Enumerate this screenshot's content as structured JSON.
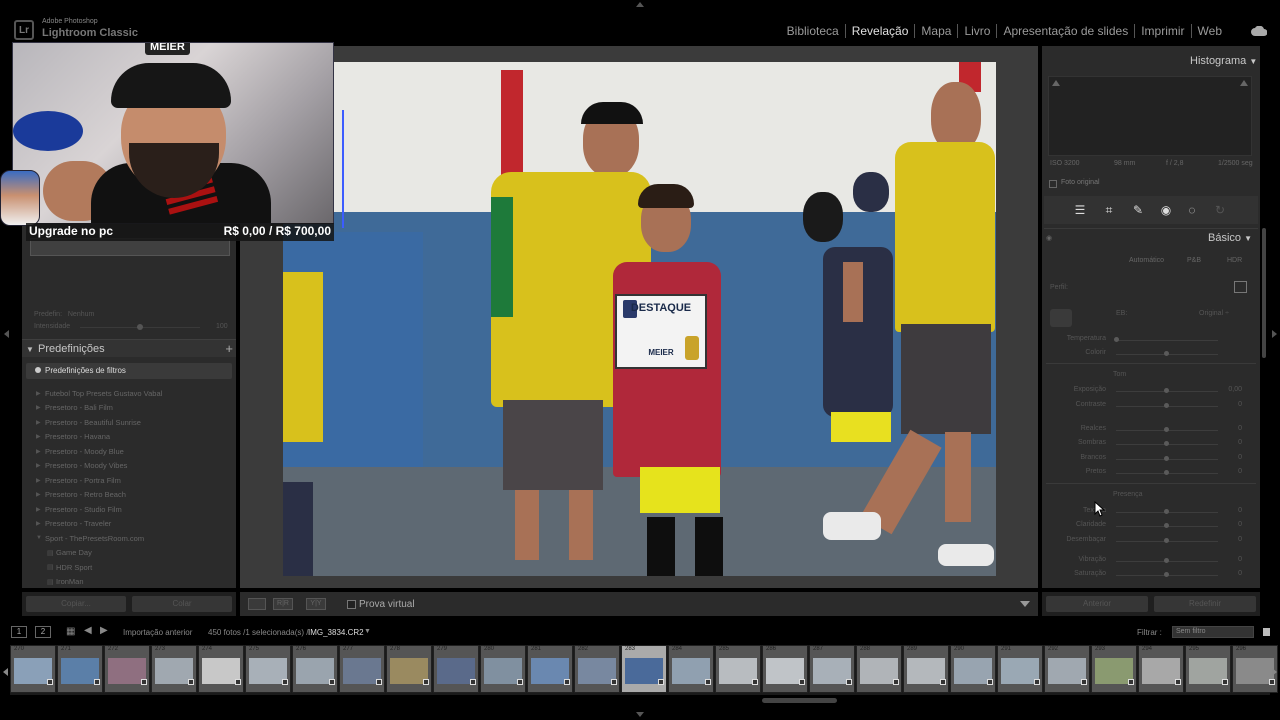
{
  "app": {
    "vendor": "Adobe Photoshop",
    "name": "Lightroom Classic"
  },
  "modules": [
    {
      "label": "Biblioteca",
      "active": false
    },
    {
      "label": "Revelação",
      "active": true
    },
    {
      "label": "Mapa",
      "active": false
    },
    {
      "label": "Livro",
      "active": false
    },
    {
      "label": "Apresentação de slides",
      "active": false
    },
    {
      "label": "Imprimir",
      "active": false
    },
    {
      "label": "Web",
      "active": false
    }
  ],
  "overlay": {
    "cap_logo": "MEIER",
    "upgrade_label": "Upgrade no pc",
    "goal": "R$ 0,00 / R$ 700,00"
  },
  "left_panel": {
    "preset_label": "Predefin:",
    "preset_value": "Nenhum",
    "intensity_label": "Intensidade",
    "intensity_value": "100",
    "intensity_fraction": 0.5,
    "presets_title": "Predefinições",
    "filter_presets": "Predefinições de filtros",
    "presets": [
      {
        "label": "Futebol Top Presets Gustavo Vabal",
        "type": "folder"
      },
      {
        "label": "Presetoro - Bali Film",
        "type": "folder"
      },
      {
        "label": "Presetoro - Beautiful Sunrise",
        "type": "folder"
      },
      {
        "label": "Presetoro - Havana",
        "type": "folder"
      },
      {
        "label": "Presetoro - Moody Blue",
        "type": "folder"
      },
      {
        "label": "Presetoro - Moody Vibes",
        "type": "folder"
      },
      {
        "label": "Presetoro - Portra Film",
        "type": "folder"
      },
      {
        "label": "Presetoro - Retro Beach",
        "type": "folder"
      },
      {
        "label": "Presetoro - Studio Film",
        "type": "folder"
      },
      {
        "label": "Presetoro - Traveler",
        "type": "folder"
      },
      {
        "label": "Sport - ThePresetsRoom.com",
        "type": "open"
      },
      {
        "label": "Game Day",
        "type": "item"
      },
      {
        "label": "HDR Sport",
        "type": "item"
      },
      {
        "label": "IronMan",
        "type": "item"
      }
    ],
    "copy_button": "Copiar...",
    "paste_button": "Colar"
  },
  "photo": {
    "certificate_title": "DESTAQUE",
    "certificate_name": "MEIER"
  },
  "center_toolbar": {
    "proof_label": "Prova virtual"
  },
  "right_panel": {
    "histogram_title": "Histograma",
    "iso": "ISO 3200",
    "focal": "98 mm",
    "aperture": "f / 2,8",
    "shutter": "1/2500 seg",
    "original_photo": "Foto original",
    "basic_title": "Básico",
    "mode_auto": "Automático",
    "mode_bw": "P&B",
    "mode_hdr": "HDR",
    "profile_label": "Perfil:",
    "wb_label": "EB:",
    "wb_value": "Original ÷",
    "tone_label": "Tom",
    "presence_label": "Presença",
    "sliders": [
      {
        "name": "Temperatura",
        "value": "",
        "pos": 0.0
      },
      {
        "name": "Colorir",
        "value": "",
        "pos": 0.5
      },
      {
        "name": "Exposição",
        "value": "0,00",
        "pos": 0.5
      },
      {
        "name": "Contraste",
        "value": "0",
        "pos": 0.5
      },
      {
        "name": "Realces",
        "value": "0",
        "pos": 0.5
      },
      {
        "name": "Sombras",
        "value": "0",
        "pos": 0.5
      },
      {
        "name": "Brancos",
        "value": "0",
        "pos": 0.5
      },
      {
        "name": "Pretos",
        "value": "0",
        "pos": 0.5
      },
      {
        "name": "Textura",
        "value": "0",
        "pos": 0.5
      },
      {
        "name": "Claridade",
        "value": "0",
        "pos": 0.5
      },
      {
        "name": "Desembaçar",
        "value": "0",
        "pos": 0.5
      },
      {
        "name": "Vibração",
        "value": "0",
        "pos": 0.5
      },
      {
        "name": "Saturação",
        "value": "0",
        "pos": 0.5
      }
    ],
    "prev_button": "Anterior",
    "reset_button": "Redefinir"
  },
  "filmbar": {
    "screen1": "1",
    "screen2": "2",
    "source": "Importação anterior",
    "count": "450 fotos /1 selecionada(s) /",
    "filename": "IMG_3834.CR2",
    "filter_label": "Filtrar :",
    "filter_value": "Sem filtro"
  },
  "filmstrip": {
    "numbers": [
      "270",
      "271",
      "272",
      "273",
      "274",
      "275",
      "276",
      "277",
      "278",
      "279",
      "280",
      "281",
      "282",
      "283",
      "284",
      "285",
      "286",
      "287",
      "288",
      "289",
      "290",
      "291",
      "292",
      "293",
      "294",
      "295",
      "296"
    ],
    "selected": "283",
    "colors": [
      "#8aa0b8",
      "#5b7fa8",
      "#8f6f80",
      "#a0a8b0",
      "#c8c8c8",
      "#a8b0b8",
      "#9aa4ae",
      "#6a7890",
      "#9a8a60",
      "#5a6a8a",
      "#8090a0",
      "#6a88b0",
      "#7888a0",
      "#4a6a9a",
      "#90a0b0",
      "#b8bcc0",
      "#c0c4c8",
      "#a8b0b8",
      "#b0b4b8",
      "#b4b8bc",
      "#98a4b0",
      "#9aa8b4",
      "#a0a8b0",
      "#8a9a70",
      "#a8a8a8",
      "#a0a4a0",
      "#8a8a8a"
    ]
  }
}
